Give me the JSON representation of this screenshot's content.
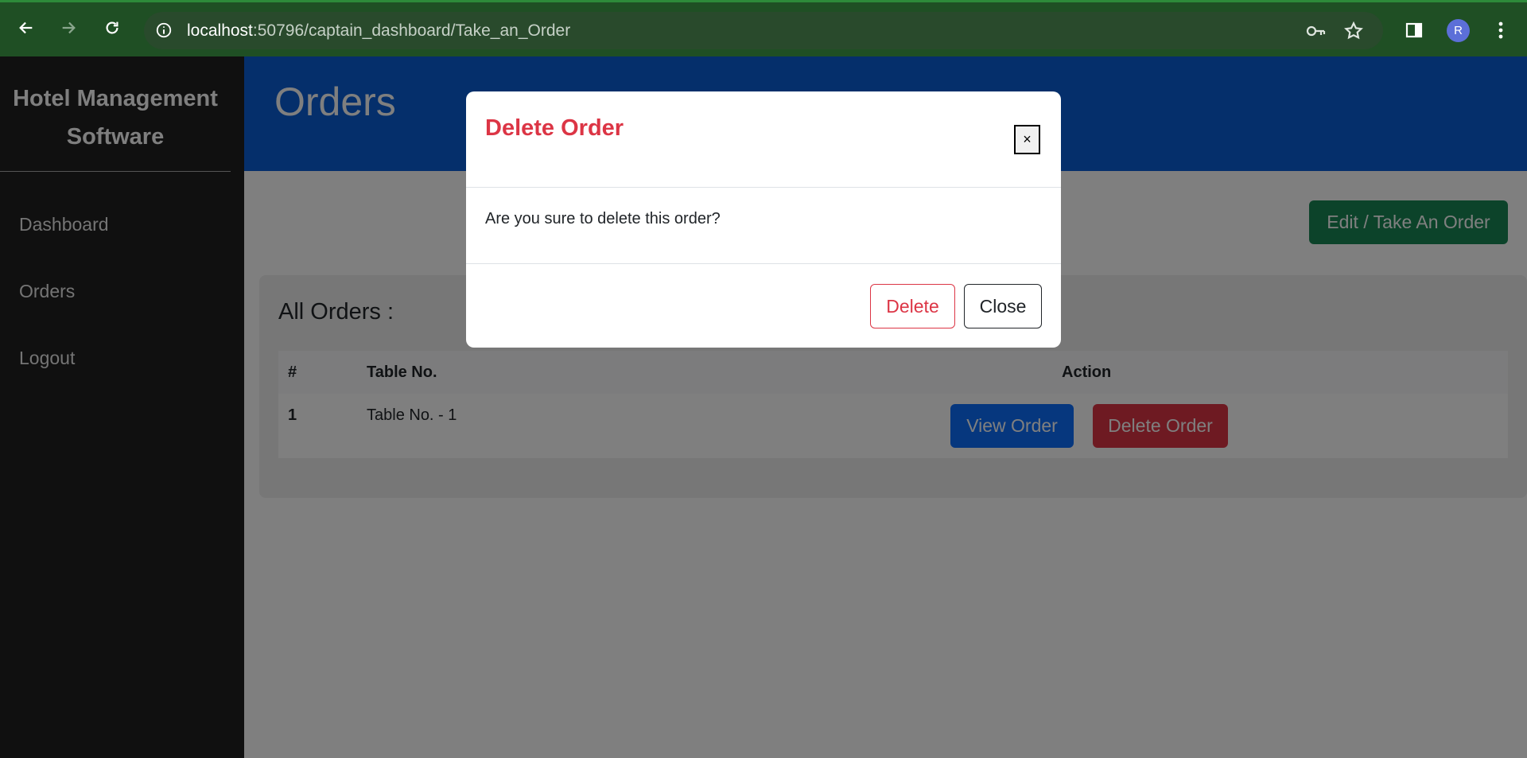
{
  "browser": {
    "url_host": "localhost",
    "url_path": ":50796/captain_dashboard/Take_an_Order",
    "avatar_letter": "R"
  },
  "sidebar": {
    "brand": "Hotel Management Software",
    "items": [
      {
        "label": "Dashboard"
      },
      {
        "label": "Orders"
      },
      {
        "label": "Logout"
      }
    ]
  },
  "header": {
    "title": "Orders"
  },
  "toolbar": {
    "edit_label": "Edit / Take An Order"
  },
  "orders": {
    "title": "All Orders :",
    "columns": [
      "#",
      "Table No.",
      "Action"
    ],
    "rows": [
      {
        "num": "1",
        "table": "Table No. - 1",
        "view_label": "View Order",
        "delete_label": "Delete Order"
      }
    ]
  },
  "modal": {
    "title": "Delete Order",
    "close_x": "×",
    "body": "Are you sure to delete this order?",
    "delete_label": "Delete",
    "close_label": "Close"
  },
  "colors": {
    "chrome": "#1f4f24",
    "header": "#0b5ed7",
    "danger": "#dc3545",
    "success": "#198754",
    "primary": "#0d6efd"
  }
}
